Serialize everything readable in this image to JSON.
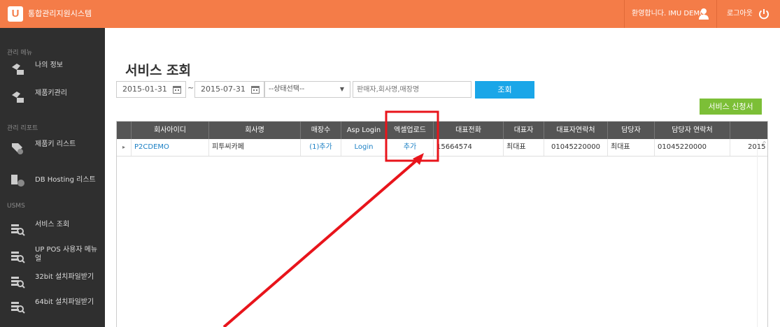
{
  "header": {
    "logo_letter": "U",
    "app_title": "통합관리지원시스템",
    "welcome": "환영합니다. IMU DEMO",
    "logout": "로그아웃"
  },
  "sidebar": {
    "sections": [
      {
        "title": "관리 메뉴",
        "items": [
          "나의 정보",
          "제품키관리"
        ]
      },
      {
        "title": "관리 리포트",
        "items": [
          "제품키 리스트",
          "DB Hosting 리스트"
        ]
      },
      {
        "title": "USMS",
        "items": [
          "서비스 조회",
          "UP POS 사용자 메뉴얼",
          "32bit 설치파일받기",
          "64bit 설치파일받기"
        ]
      }
    ]
  },
  "main": {
    "title": "서비스 조회",
    "date_from": "2015-01-31",
    "date_to": "2015-07-31",
    "date_separator": "~",
    "status_select": "--상태선택--",
    "search_placeholder": "판매자,회사명,매장명",
    "search_button": "조회",
    "apply_button": "서비스 신청서"
  },
  "grid": {
    "headers": [
      "회사아이디",
      "회사명",
      "매장수",
      "Asp Login",
      "엑셀업로드",
      "대표전화",
      "대표자",
      "대표자연락처",
      "담당자",
      "담당자 연락처",
      ""
    ],
    "rows": [
      {
        "company_id": "P2CDEMO",
        "company_name": "피투씨카페",
        "store_count": "(1)추가",
        "asp_login": "Login",
        "excel_upload": "추가",
        "phone": "15664574",
        "ceo": "최대표",
        "ceo_contact": "01045220000",
        "manager": "최대표",
        "manager_contact": "01045220000",
        "date": "2015"
      }
    ]
  },
  "colors": {
    "header": "#f47c48",
    "sidebar": "#2f2f2f",
    "search_button": "#1aa6e8",
    "apply_button": "#7cbf37",
    "annotation": "#e8141b"
  }
}
